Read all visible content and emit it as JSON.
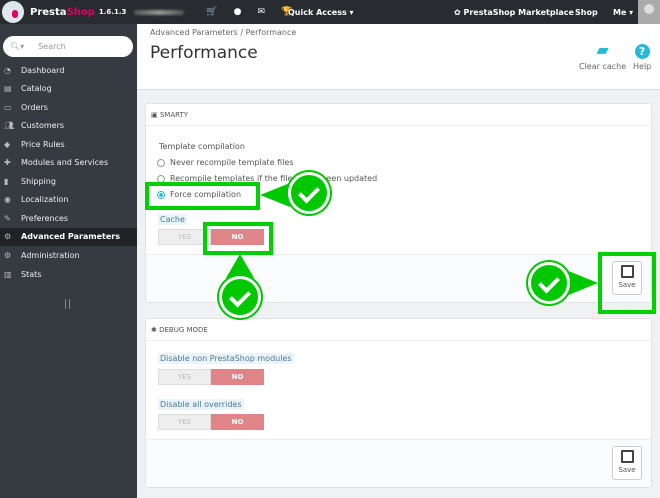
{
  "topbar": {
    "brand_a": "Presta",
    "brand_b": "Shop",
    "version": "1.6.1.3",
    "quick_access": "Quick Access ▾",
    "marketplace": "PrestaShop Marketplace",
    "shop": "Shop",
    "me": "Me ▾"
  },
  "sidebar": {
    "search_placeholder": "Search",
    "items": [
      {
        "label": "Dashboard",
        "icon": "dashboard-icon"
      },
      {
        "label": "Catalog",
        "icon": "book-icon"
      },
      {
        "label": "Orders",
        "icon": "credit-card-icon"
      },
      {
        "label": "Customers",
        "icon": "users-icon"
      },
      {
        "label": "Price Rules",
        "icon": "tag-icon"
      },
      {
        "label": "Modules and Services",
        "icon": "puzzle-icon"
      },
      {
        "label": "Shipping",
        "icon": "truck-icon"
      },
      {
        "label": "Localization",
        "icon": "globe-icon"
      },
      {
        "label": "Preferences",
        "icon": "wrench-icon"
      },
      {
        "label": "Advanced Parameters",
        "icon": "cogs-icon",
        "active": true
      },
      {
        "label": "Administration",
        "icon": "gear-icon"
      },
      {
        "label": "Stats",
        "icon": "bar-chart-icon"
      }
    ]
  },
  "header": {
    "breadcrumb": "Advanced Parameters  /  Performance",
    "title": "Performance",
    "clear_cache": "Clear cache",
    "help": "Help"
  },
  "smarty": {
    "title": "SMARTY",
    "template_label": "Template compilation",
    "options": [
      "Never recompile template files",
      "Recompile templates if the files have been updated",
      "Force compilation"
    ],
    "selected": 2,
    "cache_label": "Cache",
    "yes": "YES",
    "no": "NO",
    "cache_value": "NO",
    "save": "Save"
  },
  "debug": {
    "title": "DEBUG MODE",
    "disable_modules_label": "Disable non PrestaShop modules",
    "disable_overrides_label": "Disable all overrides",
    "yes": "YES",
    "no": "NO",
    "save": "Save"
  },
  "colors": {
    "accent": "#25b9d7",
    "brand": "#df0067",
    "highlight": "#00c800",
    "no_active": "#e08587"
  }
}
